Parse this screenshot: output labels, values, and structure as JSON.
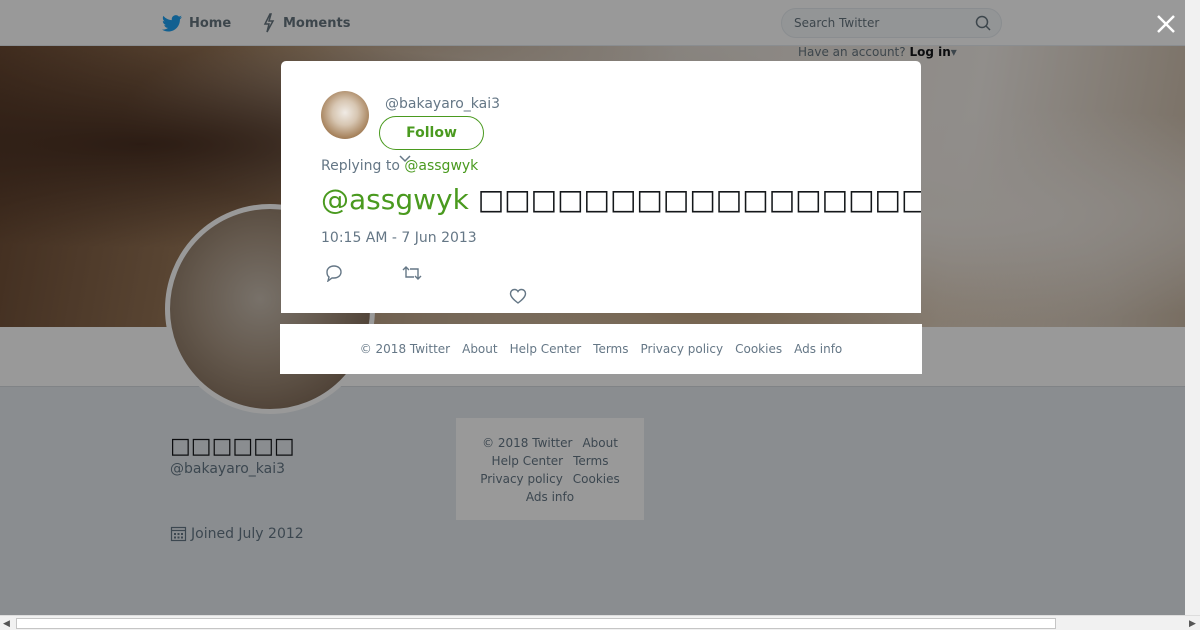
{
  "nav": {
    "home": "Home",
    "moments": "Moments",
    "search_placeholder": "Search Twitter",
    "have_account": "Have an account?",
    "login": "Log in"
  },
  "profile": {
    "display_name": "□□□□□□",
    "screen_name": "@bakayaro_kai3",
    "joined": "Joined July 2012"
  },
  "side_footer": {
    "copyright": "© 2018 Twitter",
    "about": "About",
    "help": "Help Center",
    "terms": "Terms",
    "privacy": "Privacy policy",
    "cookies": "Cookies",
    "ads": "Ads info"
  },
  "tweet": {
    "user": "@bakayaro_kai3",
    "follow_label": "Follow",
    "replying_prefix": "Replying to",
    "replying_to": "@assgwyk",
    "mention": "@assgwyk",
    "body": "□□□□□□□□□□□□□□□□□□□□□□□□□□□□□□□□□□□□□□□□□□□□□□□□□□",
    "time": "10:15 AM - 7 Jun 2013"
  },
  "modal_footer": {
    "copyright": "© 2018 Twitter",
    "about": "About",
    "help": "Help Center",
    "terms": "Terms",
    "privacy": "Privacy policy",
    "cookies": "Cookies",
    "ads": "Ads info"
  },
  "colors": {
    "accent": "#4a9a1f",
    "twitter_blue": "#1da1f2",
    "text_muted": "#657786"
  },
  "icons": [
    "twitter-bird-icon",
    "lightning-icon",
    "search-icon",
    "close-icon",
    "calendar-icon",
    "reply-icon",
    "retweet-icon",
    "heart-icon",
    "chevron-down-icon"
  ]
}
